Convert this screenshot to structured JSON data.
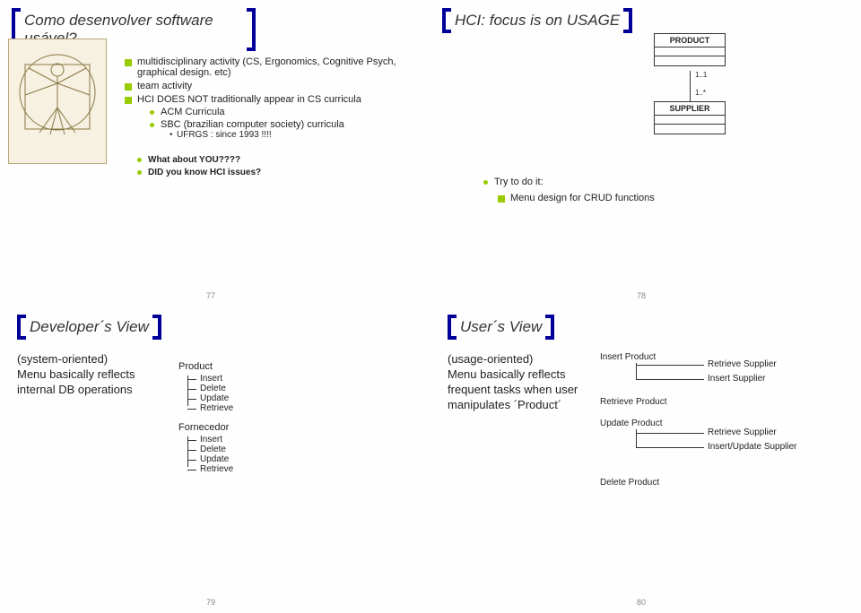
{
  "slide1": {
    "title": "Como desenvolver software usável?",
    "b1": "multidisciplinary activity (CS, Ergonomics, Cognitive Psych, graphical design. etc)",
    "b2": "team activity",
    "b3": "HCI DOES NOT traditionally appear in CS curricula",
    "b3a": "ACM Curricula",
    "b3b": "SBC (brazilian computer society) curricula",
    "b3b1": "UFRGS : since 1993 !!!!",
    "b4": "What about YOU????",
    "b5": "DID you know HCI issues?",
    "page": "77"
  },
  "slide2": {
    "title": "HCI: focus is on USAGE",
    "product": "PRODUCT",
    "supplier": "SUPPLIER",
    "card1": "1..1",
    "card2": "1..*",
    "try": "Try to do it:",
    "menu": "Menu design for CRUD functions",
    "page": "78"
  },
  "slide3": {
    "title": "Developer´s View",
    "left": "(system-oriented)\nMenu basically reflects internal DB operations",
    "tree": {
      "product": "Product",
      "fornecedor": "Fornecedor",
      "ops": [
        "Insert",
        "Delete",
        "Update",
        "Retrieve"
      ]
    },
    "page": "79"
  },
  "slide4": {
    "title": "User´s View",
    "left": "(usage-oriented)\nMenu basically reflects frequent tasks when user manipulates ´Product´",
    "n": {
      "ip": "Insert Product",
      "rs": "Retrieve Supplier",
      "is": "Insert Supplier",
      "rp": "Retrieve Product",
      "up": "Update Product",
      "rs2": "Retrieve Supplier",
      "ius": "Insert/Update Supplier",
      "dp": "Delete Product"
    },
    "page": "80"
  }
}
